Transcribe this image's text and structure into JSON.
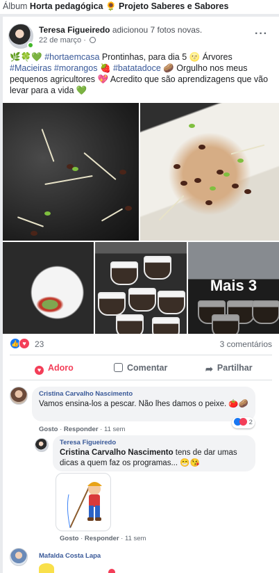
{
  "album": {
    "prefix": "Álbum",
    "album_name": "Horta pedagógica",
    "sunflower": "🌻",
    "project_name": "Projeto Saberes e Sabores"
  },
  "post": {
    "author": "Teresa Figueiredo",
    "action": "adicionou 7 fotos novas.",
    "date": "22 de março",
    "more_icon": "···",
    "text_parts": {
      "lead_emoji": "🌿🍀💚",
      "tag1": "#hortaemcasa",
      "t1": " Prontinhas, para dia 5 🌝 Árvores ",
      "tag2": "#Macieiras",
      "t2": " ",
      "tag3": "#morangos",
      "t3": " 🍓 ",
      "tag4": "#batatadoce",
      "t4": " 🥔 Orgulho nos meus pequenos agricultores 💖 Acredito que são aprendizagens que vão levar para a vida 💚"
    },
    "more_photos_label": "Mais 3",
    "reaction_count": "23",
    "comment_count": "3 comentários",
    "actions": {
      "love": "Adoro",
      "comment": "Comentar",
      "share": "Partilhar"
    }
  },
  "comments": [
    {
      "author": "Cristina Carvalho Nascimento",
      "text": "Vamos ensina-los a pescar. Não lhes damos o peixe. 🍅🥔",
      "like": "Gosto",
      "reply": "Responder",
      "time": "11 sem",
      "reactions": "2"
    },
    {
      "author": "Teresa Figueiredo",
      "mention": "Cristina Carvalho Nascimento",
      "text": " tens de dar umas dicas a quem faz os programas... 😁😘",
      "like": "Gosto",
      "reply": "Responder",
      "time": "11 sem"
    },
    {
      "author": "Mafalda Costa Lapa"
    }
  ],
  "colors": {
    "link": "#385898",
    "love": "#f33e58",
    "like": "#1877f2",
    "online": "#42b72a"
  }
}
